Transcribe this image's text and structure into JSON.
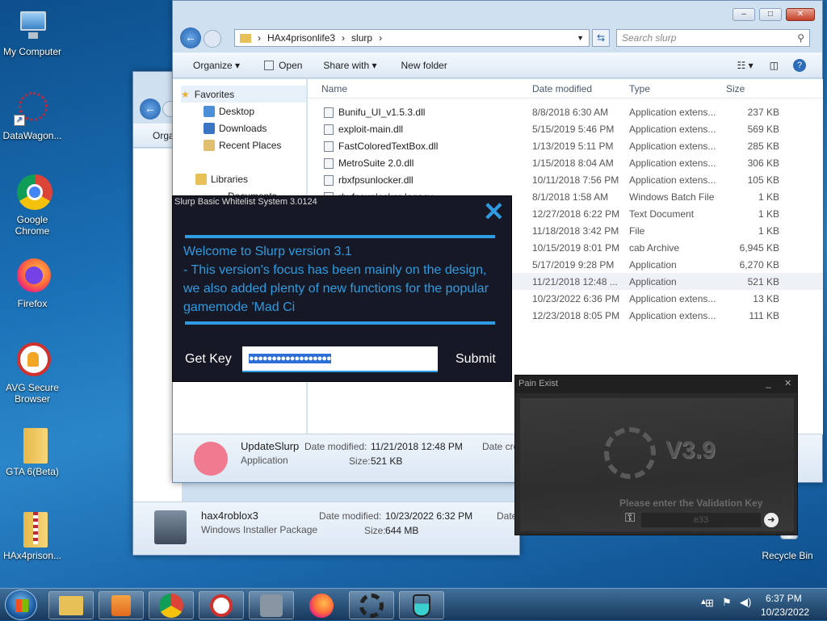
{
  "desktop": {
    "icons": [
      {
        "label": "My Computer"
      },
      {
        "label": "DataWagon..."
      },
      {
        "label": "Google Chrome"
      },
      {
        "label": "Firefox"
      },
      {
        "label": "AVG Secure Browser"
      },
      {
        "label": "GTA 6(Beta)"
      },
      {
        "label": "HAx4prison..."
      },
      {
        "label": "Recycle Bin"
      }
    ]
  },
  "explorer_front": {
    "breadcrumb": [
      "HAx4prisonlife3",
      "slurp"
    ],
    "search_placeholder": "Search slurp",
    "toolbar": {
      "organize": "Organize",
      "open": "Open",
      "share_with": "Share with",
      "new_folder": "New folder"
    },
    "nav": {
      "favorites": "Favorites",
      "desktop": "Desktop",
      "downloads": "Downloads",
      "recent": "Recent Places",
      "libraries": "Libraries",
      "documents": "Documents"
    },
    "columns": {
      "name": "Name",
      "date": "Date modified",
      "type": "Type",
      "size": "Size"
    },
    "files": [
      {
        "name": "Bunifu_UI_v1.5.3.dll",
        "date": "8/8/2018 6:30 AM",
        "type": "Application extens...",
        "size": "237 KB"
      },
      {
        "name": "exploit-main.dll",
        "date": "5/15/2019 5:46 PM",
        "type": "Application extens...",
        "size": "569 KB"
      },
      {
        "name": "FastColoredTextBox.dll",
        "date": "1/13/2019 5:11 PM",
        "type": "Application extens...",
        "size": "285 KB"
      },
      {
        "name": "MetroSuite 2.0.dll",
        "date": "1/15/2018 8:04 AM",
        "type": "Application extens...",
        "size": "306 KB"
      },
      {
        "name": "rbxfpsunlocker.dll",
        "date": "10/11/2018 7:56 PM",
        "type": "Application extens...",
        "size": "105 KB"
      },
      {
        "name": "rbxfpsunlocker-legacy",
        "date": "8/1/2018 1:58 AM",
        "type": "Windows Batch File",
        "size": "1 KB"
      },
      {
        "name": "",
        "date": "12/27/2018 6:22 PM",
        "type": "Text Document",
        "size": "1 KB"
      },
      {
        "name": "",
        "date": "11/18/2018 3:42 PM",
        "type": "File",
        "size": "1 KB"
      },
      {
        "name": "",
        "date": "10/15/2019 8:01 PM",
        "type": "cab Archive",
        "size": "6,945 KB"
      },
      {
        "name": "",
        "date": "5/17/2019 9:28 PM",
        "type": "Application",
        "size": "6,270 KB"
      },
      {
        "name": "",
        "date": "11/21/2018 12:48 ...",
        "type": "Application",
        "size": "521 KB"
      },
      {
        "name": "",
        "date": "10/23/2022 6:36 PM",
        "type": "Application extens...",
        "size": "13 KB"
      },
      {
        "name": "",
        "date": "12/23/2018 8:05 PM",
        "type": "Application extens...",
        "size": "111 KB"
      }
    ],
    "details": {
      "name": "UpdateSlurp",
      "kind": "Application",
      "date_label": "Date modified:",
      "date": "11/21/2018 12:48 PM",
      "size_label": "Size:",
      "size": "521 KB",
      "created_label": "Date cre"
    }
  },
  "explorer_back": {
    "organize": "Orga",
    "details": {
      "name": "hax4roblox3",
      "kind": "Windows Installer Package",
      "date_label": "Date modified:",
      "date": "10/23/2022 6:32 PM",
      "size_label": "Size:",
      "size": "644 MB",
      "created_label": "Date"
    }
  },
  "slurp_dialog": {
    "title": "Slurp Basic Whitelist System 3.0124",
    "message": "Welcome to Slurp version 3.1\n- This version's focus has been mainly on the design, we also added plenty of new functions for the popular gamemode 'Mad Ci",
    "get_key": "Get Key",
    "key_value": "●●●●●●●●●●●●●●●●●●",
    "submit": "Submit",
    "accent": "#2f9be0"
  },
  "pain_exist": {
    "title": "Pain Exist",
    "version": "V3.9",
    "prompt": "Please enter the Validation Key",
    "key_value": "e33"
  },
  "tray": {
    "time": "6:37 PM",
    "date": "10/23/2022"
  }
}
